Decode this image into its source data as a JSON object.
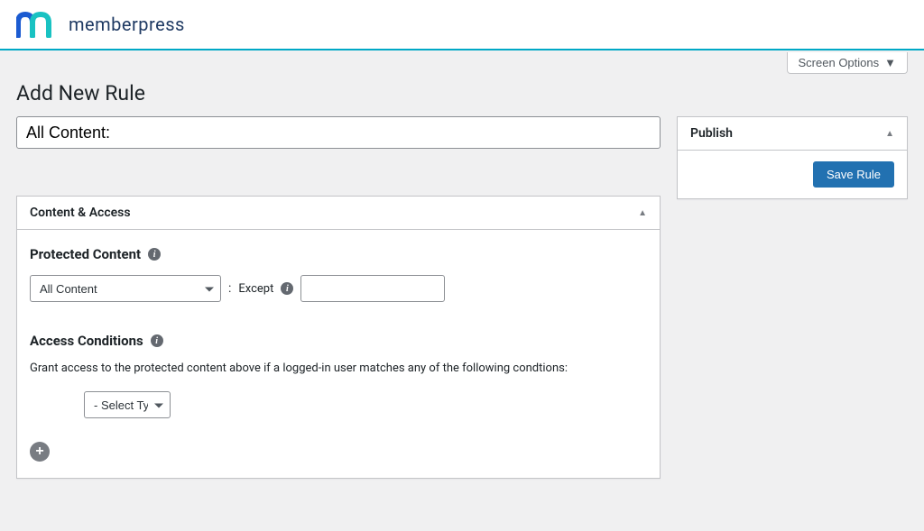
{
  "brand": {
    "name": "memberpress"
  },
  "screen_options": {
    "label": "Screen Options"
  },
  "page": {
    "title": "Add New Rule"
  },
  "title_input": {
    "value": "All Content:"
  },
  "content_box": {
    "title": "Content & Access",
    "protected_label": "Protected Content",
    "protected_select_value": "All Content",
    "except_label": "Except",
    "except_value": "",
    "access_label": "Access Conditions",
    "access_desc": "Grant access to the protected content above if a logged-in user matches any of the following condtions:",
    "type_select_value": "- Select Typ"
  },
  "publish_box": {
    "title": "Publish",
    "save_label": "Save Rule"
  }
}
